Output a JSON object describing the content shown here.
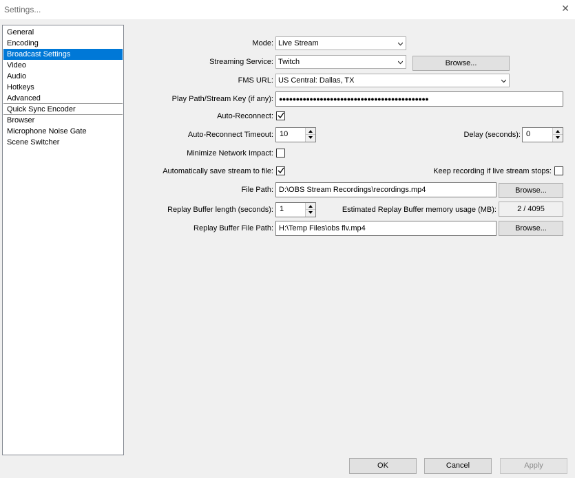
{
  "window": {
    "title": "Settings...",
    "close_glyph": "✕"
  },
  "sidebar": {
    "items": [
      "General",
      "Encoding",
      "Broadcast Settings",
      "Video",
      "Audio",
      "Hotkeys",
      "Advanced",
      "Quick Sync Encoder",
      "Browser",
      "Microphone Noise Gate",
      "Scene Switcher"
    ],
    "selected": "Broadcast Settings"
  },
  "form": {
    "mode_label": "Mode:",
    "mode_value": "Live Stream",
    "service_label": "Streaming Service:",
    "service_value": "Twitch",
    "service_browse": "Browse...",
    "fms_label": "FMS URL:",
    "fms_value": "US Central: Dallas, TX",
    "key_label": "Play Path/Stream Key (if any):",
    "key_value": "●●●●●●●●●●●●●●●●●●●●●●●●●●●●●●●●●●●●●●●●●●●●",
    "reconnect_label": "Auto-Reconnect:",
    "reconnect_checked": true,
    "reconnect_timeout_label": "Auto-Reconnect Timeout:",
    "reconnect_timeout_value": "10",
    "delay_label": "Delay (seconds):",
    "delay_value": "0",
    "min_network_label": "Minimize Network Impact:",
    "min_network_checked": false,
    "autosave_label": "Automatically save stream to file:",
    "autosave_checked": true,
    "keep_recording_label": "Keep recording if live stream stops:",
    "keep_recording_checked": false,
    "file_path_label": "File Path:",
    "file_path_value": "D:\\OBS Stream Recordings\\recordings.mp4",
    "file_path_browse": "Browse...",
    "replay_len_label": "Replay Buffer length (seconds):",
    "replay_len_value": "1",
    "replay_mem_label": "Estimated Replay Buffer memory usage (MB):",
    "replay_mem_value": "2 / 4095",
    "replay_path_label": "Replay Buffer File Path:",
    "replay_path_value": "H:\\Temp Files\\obs flv.mp4",
    "replay_path_browse": "Browse..."
  },
  "footer": {
    "ok": "OK",
    "cancel": "Cancel",
    "apply": "Apply"
  },
  "icons": {
    "close": "close-icon",
    "dropdown": "chevron-down-icon",
    "check": "checkmark-icon"
  },
  "colors": {
    "selection": "#0078d7",
    "background": "#f0f0f0"
  }
}
